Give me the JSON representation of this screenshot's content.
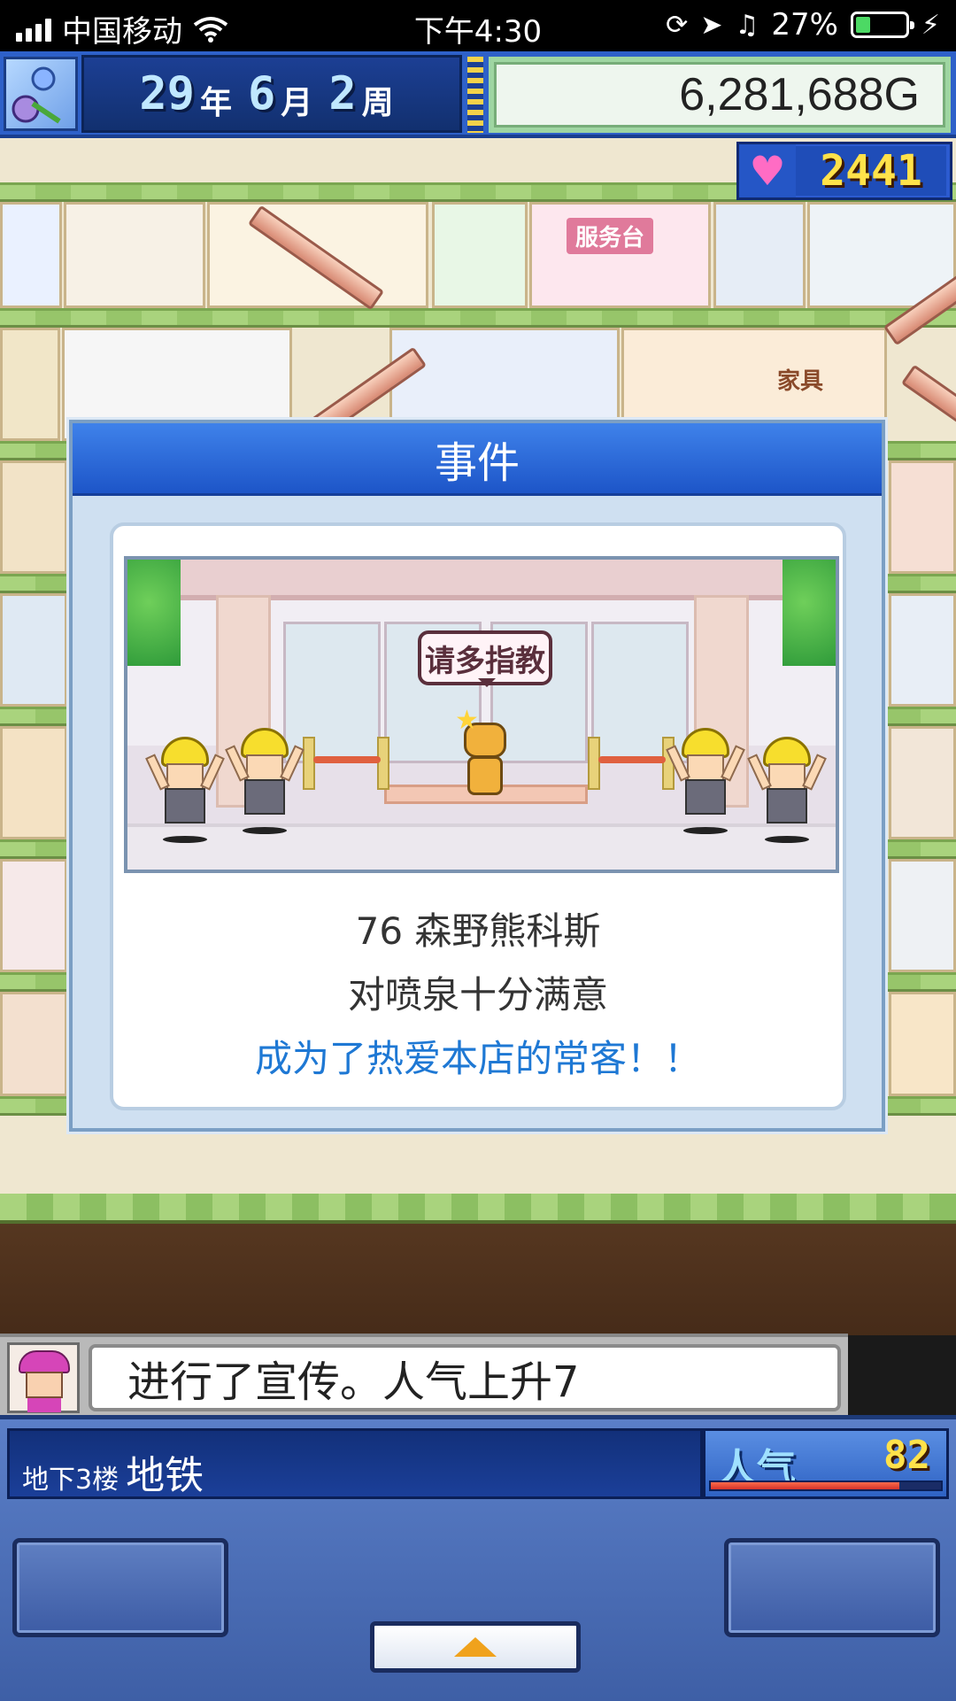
{
  "status_bar": {
    "carrier": "中国移动",
    "time": "下午4:30",
    "battery": "27%",
    "battery_level": 0.27
  },
  "hud": {
    "year": "29",
    "year_unit": "年",
    "month": "6",
    "month_unit": "月",
    "week": "2",
    "week_unit": "周",
    "money": "6,281,688G",
    "hearts": "2441"
  },
  "world_signs": {
    "service_counter": "服务台",
    "furniture": "家具"
  },
  "event": {
    "title": "事件",
    "speech": "请多指教",
    "line1": "76 森野熊科斯",
    "line2": "对喷泉十分满意",
    "line3": "成为了热爱本店的常客！！"
  },
  "message": {
    "text": "进行了宣传。人气上升7"
  },
  "floor": {
    "level": "地下3楼",
    "name": "地铁"
  },
  "popularity": {
    "label": "人气",
    "value": "82",
    "fill": 0.82
  },
  "colors": {
    "accent_blue": "#1e78d4",
    "hud_blue": "#2e61c9",
    "gold": "#ffe24a"
  }
}
